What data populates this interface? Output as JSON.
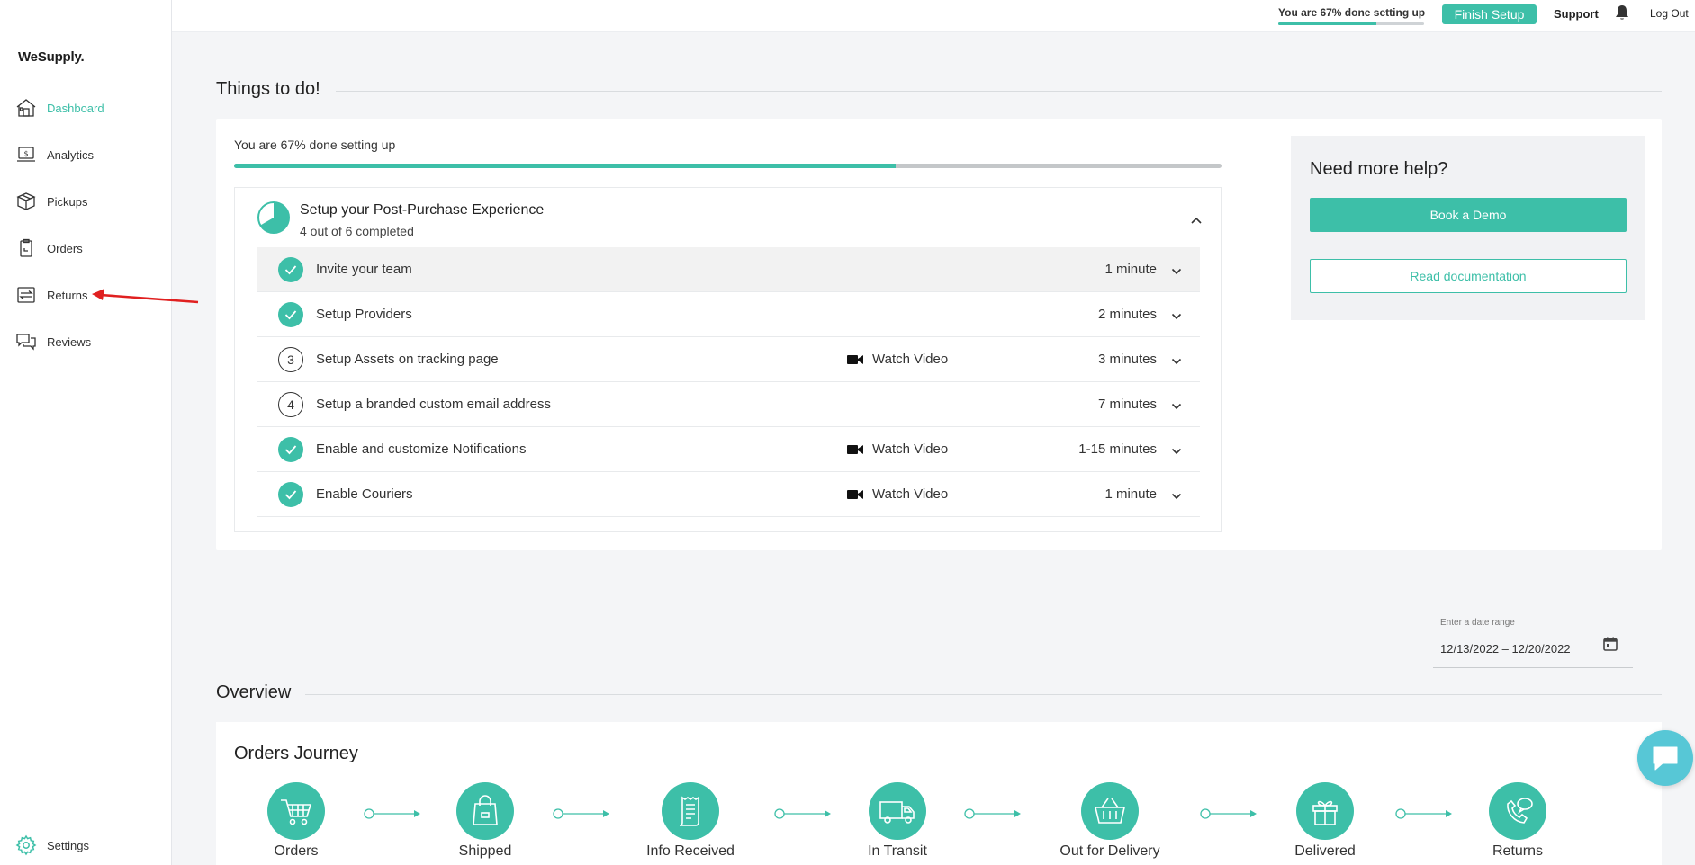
{
  "app": {
    "logo": "WeSupply."
  },
  "sidebar": {
    "items": [
      {
        "label": "Dashboard",
        "icon": "home-icon",
        "active": true
      },
      {
        "label": "Analytics",
        "icon": "analytics-icon"
      },
      {
        "label": "Pickups",
        "icon": "box-icon"
      },
      {
        "label": "Orders",
        "icon": "clipboard-icon"
      },
      {
        "label": "Returns",
        "icon": "returns-icon"
      },
      {
        "label": "Reviews",
        "icon": "chat-icon"
      }
    ],
    "settings": {
      "label": "Settings",
      "icon": "gear-icon"
    }
  },
  "topbar": {
    "progress_text": "You are 67% done setting up",
    "progress_value": 0.67,
    "finish_label": "Finish Setup",
    "support_label": "Support",
    "logout_label": "Log Out"
  },
  "todo": {
    "heading": "Things to do!",
    "progress_text": "You are 67% done setting up",
    "progress_value": 0.67,
    "checklist": {
      "title": "Setup your Post-Purchase Experience",
      "subtitle": "4 out of 6 completed",
      "tasks": [
        {
          "label": "Invite your team",
          "status": "done",
          "duration": "1 minute",
          "video": ""
        },
        {
          "label": "Setup Providers",
          "status": "done",
          "duration": "2 minutes",
          "video": ""
        },
        {
          "label": "Setup Assets on tracking page",
          "status": "3",
          "duration": "3 minutes",
          "video": "Watch Video"
        },
        {
          "label": "Setup a branded custom email address",
          "status": "4",
          "duration": "7 minutes",
          "video": ""
        },
        {
          "label": "Enable and customize Notifications",
          "status": "done",
          "duration": "1-15 minutes",
          "video": "Watch Video"
        },
        {
          "label": "Enable Couriers",
          "status": "done",
          "duration": "1 minute",
          "video": "Watch Video"
        }
      ]
    }
  },
  "help": {
    "title": "Need more help?",
    "demo_label": "Book a Demo",
    "docs_label": "Read documentation"
  },
  "date_range": {
    "label": "Enter a date range",
    "value": "12/13/2022 – 12/20/2022"
  },
  "overview": {
    "heading": "Overview",
    "journey_title": "Orders Journey",
    "steps": [
      {
        "label": "Orders",
        "icon": "cart-icon"
      },
      {
        "label": "Shipped",
        "icon": "shopping-bag-icon"
      },
      {
        "label": "Info Received",
        "icon": "receipt-icon"
      },
      {
        "label": "In Transit",
        "icon": "truck-icon"
      },
      {
        "label": "Out for Delivery",
        "icon": "basket-icon"
      },
      {
        "label": "Delivered",
        "icon": "gift-icon"
      },
      {
        "label": "Returns",
        "icon": "phone-return-icon"
      }
    ]
  },
  "colors": {
    "accent": "#3dbfa8",
    "annotation": "#e02020",
    "chat": "#57c7d6"
  }
}
